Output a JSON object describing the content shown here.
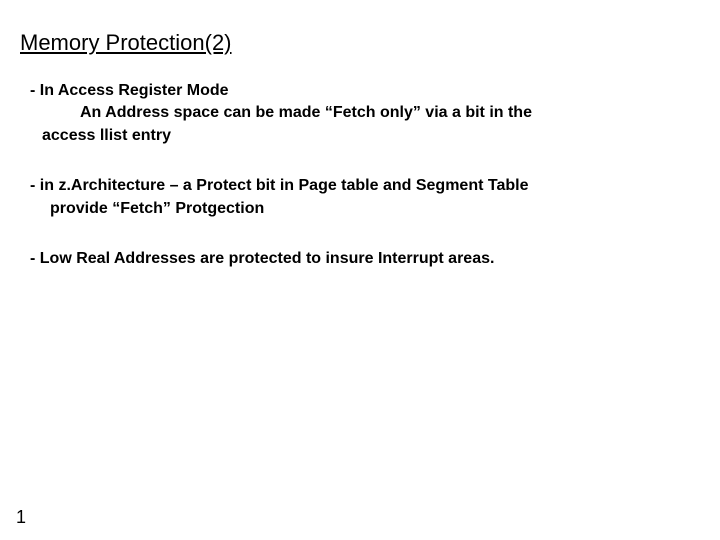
{
  "title": "Memory Protection(2)",
  "bullets": [
    {
      "lead": "- In Access Register Mode",
      "sub": "An Address space can be made “Fetch only” via a bit in the",
      "cont": "access llist entry"
    },
    {
      "lead": "- in z.Architecture – a Protect bit in Page table and Segment Table",
      "cont": "provide “Fetch” Protgection"
    },
    {
      "lead": "- Low Real Addresses are protected to insure Interrupt areas."
    }
  ],
  "page_number": "1"
}
